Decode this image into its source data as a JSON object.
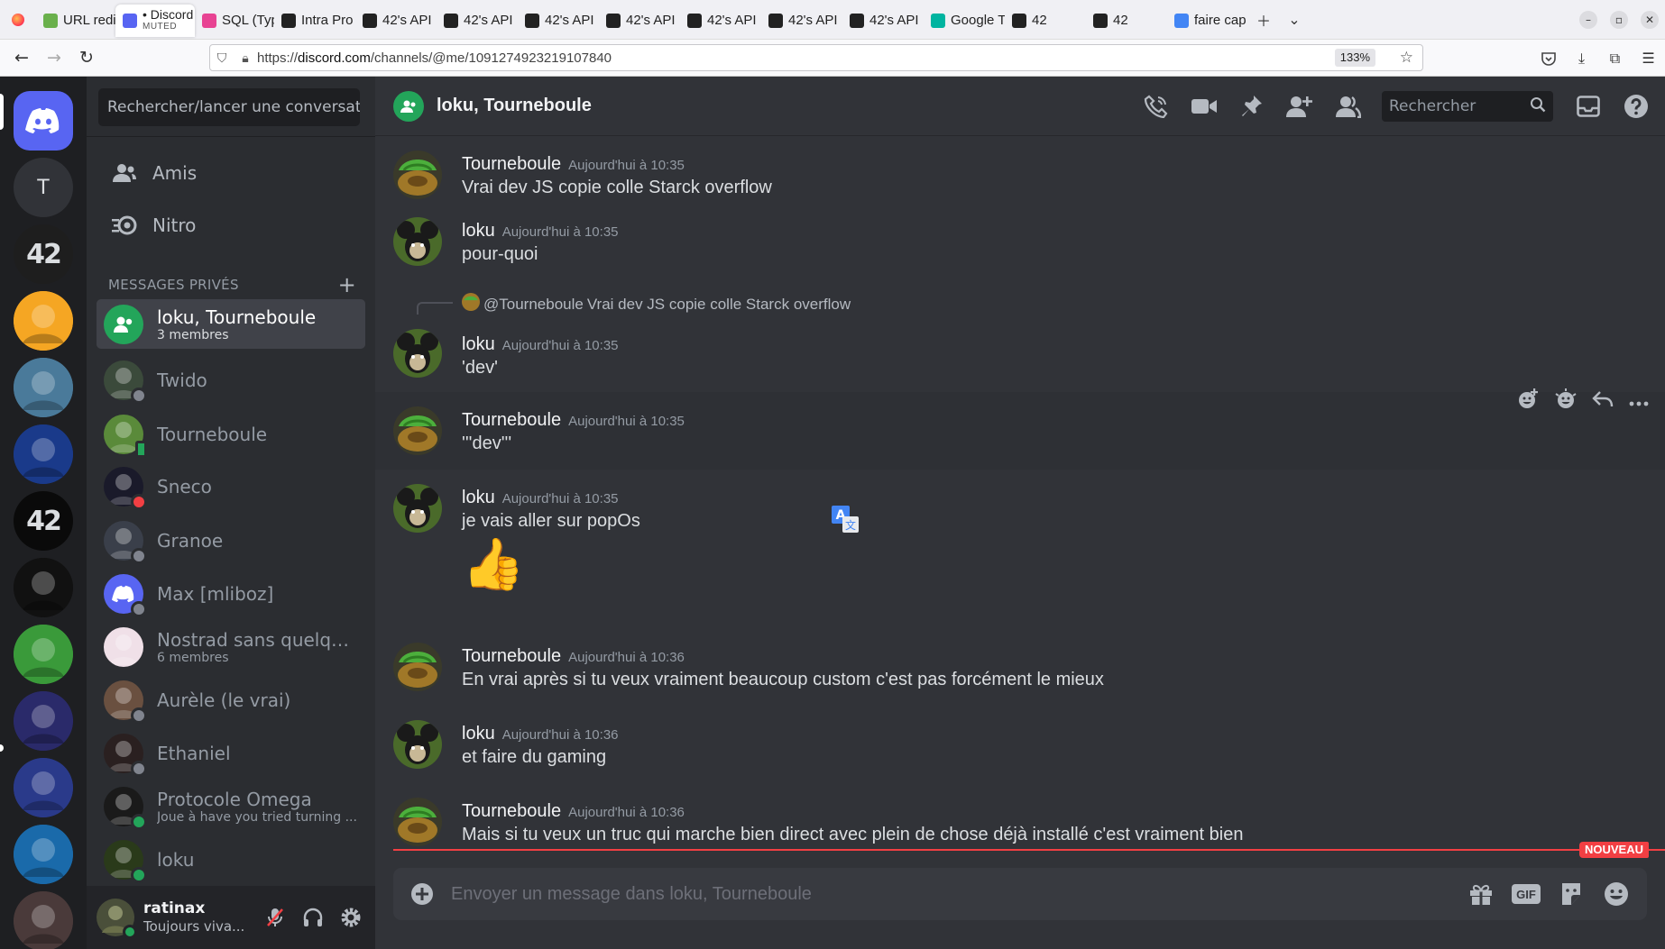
{
  "browser": {
    "tabs": [
      {
        "label": "URL redi",
        "fav_color": "#6ab04c"
      },
      {
        "label": "• Discord",
        "sub": "MUTED",
        "fav_color": "#5865f2",
        "active": true
      },
      {
        "label": "SQL (Typ",
        "fav_color": "#e84393"
      },
      {
        "label": "Intra Pro",
        "fav_color": "#222222"
      },
      {
        "label": "42's API",
        "fav_color": "#222222"
      },
      {
        "label": "42's API",
        "fav_color": "#222222"
      },
      {
        "label": "42's API",
        "fav_color": "#222222"
      },
      {
        "label": "42's API",
        "fav_color": "#222222"
      },
      {
        "label": "42's API",
        "fav_color": "#222222"
      },
      {
        "label": "42's API",
        "fav_color": "#222222"
      },
      {
        "label": "42's API",
        "fav_color": "#222222"
      },
      {
        "label": "Google T",
        "fav_color": "#00b4a0"
      },
      {
        "label": "42",
        "fav_color": "#222222"
      },
      {
        "label": "42",
        "fav_color": "#222222"
      },
      {
        "label": "faire cap",
        "fav_color": "#4285f4"
      }
    ],
    "url_prefix": "https://",
    "url_domain": "discord.com",
    "url_path": "/channels/@me/1091274923219107840",
    "zoom": "133%"
  },
  "sidebar": {
    "search_placeholder": "Rechercher/lancer une conversat...",
    "nav": [
      {
        "label": "Amis",
        "icon": "friends-icon"
      },
      {
        "label": "Nitro",
        "icon": "nitro-icon"
      }
    ],
    "dm_header": "MESSAGES PRIVÉS",
    "dms": [
      {
        "name": "loku, Tourneboule",
        "sub": "3 membres",
        "active": true,
        "avatar_color": "#23a55a",
        "status": ""
      },
      {
        "name": "Twido",
        "sub": "",
        "avatar_color": "#3b4a3b",
        "status": "offline"
      },
      {
        "name": "Tourneboule",
        "sub": "",
        "avatar_color": "#5a8a3a",
        "status": "mobile"
      },
      {
        "name": "Sneco",
        "sub": "",
        "avatar_color": "#1a1a2a",
        "status": "dnd"
      },
      {
        "name": "Granoe",
        "sub": "",
        "avatar_color": "#3a3f4a",
        "status": "offline"
      },
      {
        "name": "Max [mliboz]",
        "sub": "",
        "avatar_color": "#5865f2",
        "status": "offline"
      },
      {
        "name": "Nostrad sans quelqu'u...",
        "sub": "6 membres",
        "avatar_color": "#f0e0e8",
        "status": ""
      },
      {
        "name": "Aurèle (le vrai)",
        "sub": "",
        "avatar_color": "#6a5040",
        "status": "offline"
      },
      {
        "name": "Ethaniel",
        "sub": "",
        "avatar_color": "#2a2020",
        "status": "offline"
      },
      {
        "name": "Protocole Omega",
        "sub": "Joue à have you tried turning ...",
        "avatar_color": "#1a1a1a",
        "status": "online"
      },
      {
        "name": "loku",
        "sub": "",
        "avatar_color": "#2a3a1a",
        "status": "online"
      }
    ],
    "user": {
      "name": "ratinax",
      "status": "Toujours viva..."
    }
  },
  "guilds": [
    {
      "kind": "home",
      "label": "",
      "color": "#5865f2"
    },
    {
      "kind": "text",
      "label": "T",
      "color": "#313338"
    },
    {
      "kind": "text",
      "label": "42",
      "color": "#1e1e1e"
    },
    {
      "kind": "img",
      "label": "",
      "color": "#f5a623"
    },
    {
      "kind": "img",
      "label": "",
      "color": "#4a7a9a"
    },
    {
      "kind": "img",
      "label": "",
      "color": "#1a3a8a"
    },
    {
      "kind": "text",
      "label": "42",
      "color": "#0a0a0a"
    },
    {
      "kind": "img",
      "label": "",
      "color": "#111111"
    },
    {
      "kind": "img",
      "label": "",
      "color": "#3a9a3a"
    },
    {
      "kind": "img",
      "label": "",
      "color": "#2a2a6a"
    },
    {
      "kind": "img",
      "label": "",
      "color": "#2a3a8a"
    },
    {
      "kind": "img",
      "label": "",
      "color": "#1a6aaa"
    },
    {
      "kind": "img",
      "label": "",
      "color": "#4a3a3a"
    }
  ],
  "chat": {
    "title": "loku, Tourneboule",
    "search_placeholder": "Rechercher",
    "messages": [
      {
        "author": "Tourneboule",
        "time": "Aujourd'hui à 10:35",
        "text": "Vrai dev JS copie colle Starck overflow",
        "avatar": "tourneboule"
      },
      {
        "author": "loku",
        "time": "Aujourd'hui à 10:35",
        "text": "pour-quoi",
        "avatar": "loku"
      },
      {
        "author": "loku",
        "time": "Aujourd'hui à 10:35",
        "text": "'dev'",
        "avatar": "loku",
        "reply_to": "@Tourneboule",
        "reply_text": "Vrai dev JS copie colle Starck overflow"
      },
      {
        "author": "Tourneboule",
        "time": "Aujourd'hui à 10:35",
        "text": "'''dev'''",
        "avatar": "tourneboule"
      },
      {
        "author": "loku",
        "time": "Aujourd'hui à 10:35",
        "text": "je vais aller sur popOs",
        "avatar": "loku",
        "emoji": "👍"
      },
      {
        "author": "Tourneboule",
        "time": "Aujourd'hui à 10:36",
        "text": "En vrai après si tu veux vraiment beaucoup custom c'est pas forcément le mieux",
        "avatar": "tourneboule"
      },
      {
        "author": "loku",
        "time": "Aujourd'hui à 10:36",
        "text": "et faire du gaming",
        "avatar": "loku"
      },
      {
        "author": "Tourneboule",
        "time": "Aujourd'hui à 10:36",
        "text": "Mais si tu veux un truc qui marche bien direct avec plein de chose déjà installé c'est vraiment bien",
        "avatar": "tourneboule"
      }
    ],
    "new_badge": "NOUVEAU",
    "composer_placeholder": "Envoyer un message dans loku, Tourneboule",
    "gif_label": "GIF"
  },
  "colors": {
    "blurple": "#5865f2",
    "green": "#23a55a",
    "red": "#f23f43",
    "bg_main": "#313338",
    "bg_sidebar": "#2b2d31",
    "bg_guilds": "#1e1f22"
  }
}
